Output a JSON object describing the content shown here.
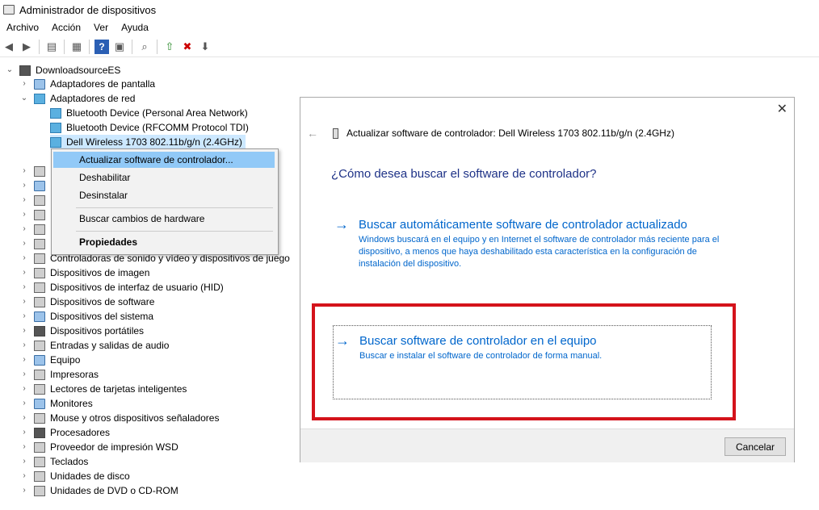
{
  "window": {
    "title": "Administrador de dispositivos"
  },
  "menu": [
    "Archivo",
    "Acción",
    "Ver",
    "Ayuda"
  ],
  "tree": {
    "root": "DownloadsourceES",
    "items": [
      {
        "label": "Adaptadores de pantalla",
        "icon": "display-adapter-icon",
        "expanded": false
      },
      {
        "label": "Adaptadores de red",
        "icon": "network-adapter-icon",
        "expanded": true
      },
      {
        "label": "Bluetooth Device (Personal Area Network)",
        "icon": "network-adapter-icon",
        "child": true
      },
      {
        "label": "Bluetooth Device (RFCOMM Protocol TDI)",
        "icon": "network-adapter-icon",
        "child": true
      },
      {
        "label": "Dell Wireless 1703 802.11b/g/n (2.4GHz)",
        "icon": "network-adapter-icon",
        "child": true,
        "selected": true
      },
      {
        "label": "",
        "icon": "batteries-icon"
      },
      {
        "label": "",
        "icon": "bluetooth-icon"
      },
      {
        "label": "",
        "icon": "computer-icon"
      },
      {
        "label": "",
        "icon": "ide-controller-icon"
      },
      {
        "label": "",
        "icon": "disk-controller-icon"
      },
      {
        "label": "",
        "icon": "usb-controller-icon"
      },
      {
        "label": "Controladoras de sonido y vídeo y dispositivos de juego",
        "icon": "sound-icon"
      },
      {
        "label": "Dispositivos de imagen",
        "icon": "camera-icon"
      },
      {
        "label": "Dispositivos de interfaz de usuario (HID)",
        "icon": "hid-icon"
      },
      {
        "label": "Dispositivos de software",
        "icon": "software-device-icon"
      },
      {
        "label": "Dispositivos del sistema",
        "icon": "system-device-icon"
      },
      {
        "label": "Dispositivos portátiles",
        "icon": "portable-device-icon"
      },
      {
        "label": "Entradas y salidas de audio",
        "icon": "audio-io-icon"
      },
      {
        "label": "Equipo",
        "icon": "computer-icon"
      },
      {
        "label": "Impresoras",
        "icon": "printer-icon"
      },
      {
        "label": "Lectores de tarjetas inteligentes",
        "icon": "smart-card-icon"
      },
      {
        "label": "Monitores",
        "icon": "monitor-icon"
      },
      {
        "label": "Mouse y otros dispositivos señaladores",
        "icon": "mouse-icon"
      },
      {
        "label": "Procesadores",
        "icon": "processor-icon"
      },
      {
        "label": "Proveedor de impresión WSD",
        "icon": "printer-icon"
      },
      {
        "label": "Teclados",
        "icon": "keyboard-icon"
      },
      {
        "label": "Unidades de disco",
        "icon": "disk-drive-icon"
      },
      {
        "label": "Unidades de DVD o CD-ROM",
        "icon": "dvd-drive-icon"
      }
    ]
  },
  "context_menu": {
    "update": "Actualizar software de controlador...",
    "disable": "Deshabilitar",
    "uninstall": "Desinstalar",
    "scan": "Buscar cambios de hardware",
    "properties": "Propiedades"
  },
  "dialog": {
    "title": "Actualizar software de controlador: Dell Wireless 1703 802.11b/g/n (2.4GHz)",
    "question": "¿Cómo desea buscar el software de controlador?",
    "option1": {
      "label": "Buscar automáticamente software de controlador actualizado",
      "description": "Windows buscará en el equipo y en Internet el software de controlador más reciente para el dispositivo, a menos que haya deshabilitado esta característica en la configuración de instalación del dispositivo."
    },
    "option2": {
      "label": "Buscar software de controlador en el equipo",
      "description": "Buscar e instalar el software de controlador de forma manual."
    },
    "cancel": "Cancelar"
  },
  "colors": {
    "link": "#0066cc",
    "question": "#1e3287",
    "highlight": "#d4131b",
    "selection": "#91c9f7"
  }
}
